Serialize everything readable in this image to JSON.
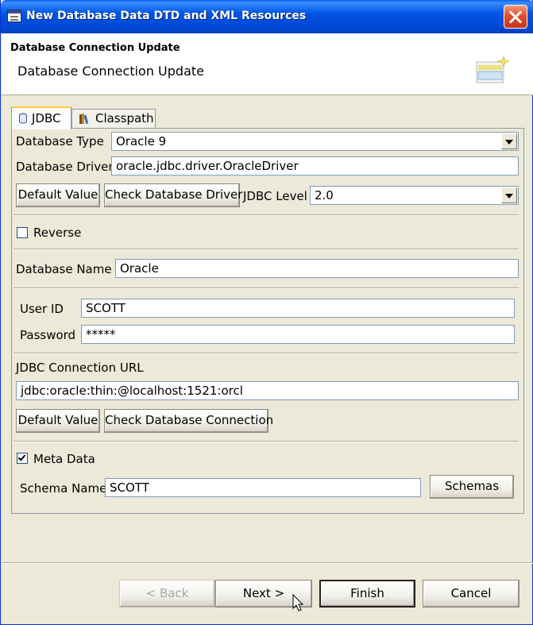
{
  "window": {
    "title": "New Database Data DTD and XML Resources"
  },
  "banner": {
    "title": "Database Connection Update",
    "description": "Database Connection Update"
  },
  "tabs": [
    {
      "label": "JDBC",
      "icon": "database-icon",
      "selected": true
    },
    {
      "label": "Classpath",
      "icon": "books-icon",
      "selected": false
    }
  ],
  "jdbc": {
    "database_type_label": "Database Type",
    "database_type_value": "Oracle 9",
    "database_driver_label": "Database Driver",
    "database_driver_value": "oracle.jdbc.driver.OracleDriver",
    "default_value_button": "Default Value",
    "check_driver_button": "Check Database Driver",
    "jdbc_level_label": "JDBC Level",
    "jdbc_level_value": "2.0",
    "reverse_label": "Reverse",
    "reverse_checked": false,
    "database_name_label": "Database Name",
    "database_name_value": "Oracle",
    "user_id_label": "User ID",
    "user_id_value": "SCOTT",
    "password_label": "Password",
    "password_value": "*****",
    "connection_url_label": "JDBC Connection URL",
    "connection_url_value": "jdbc:oracle:thin:@localhost:1521:orcl",
    "default_value_button_2": "Default Value",
    "check_connection_button": "Check Database Connection",
    "meta_data_label": "Meta Data",
    "meta_data_checked": true,
    "schema_name_label": "Schema Name",
    "schema_name_value": "SCOTT",
    "schemas_button": "Schemas"
  },
  "footer": {
    "back_button": "< Back",
    "next_button": "Next >",
    "finish_button": "Finish",
    "cancel_button": "Cancel"
  },
  "colors": {
    "titlebar": "#0055E5",
    "dialog_bg": "#ECE9D8",
    "field_border": "#7F9DB9",
    "tab_highlight": "#FFC83C"
  }
}
